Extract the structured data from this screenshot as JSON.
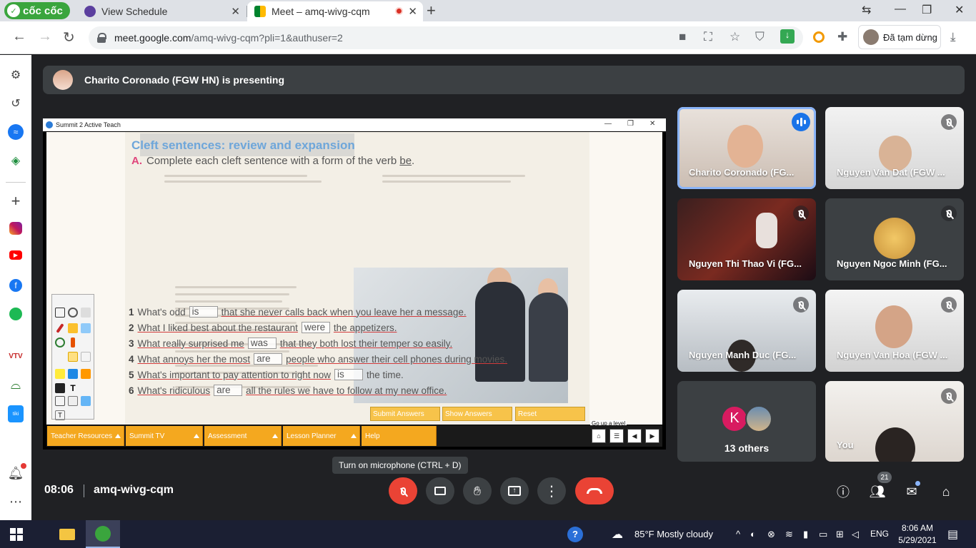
{
  "browser": {
    "brand": "cốc cốc",
    "tabs": [
      {
        "title": "View Schedule",
        "active": false
      },
      {
        "title": "Meet – amq-wivg-cqm",
        "active": true
      }
    ],
    "url_host": "meet.google.com",
    "url_path": "/amq-wivg-cqm?pli=1&authuser=2",
    "profile_label": "Đã tạm dừng"
  },
  "presenting_banner": "Charito Coronado (FGW HN) is presenting",
  "shared_window": {
    "title": "Summit 2 Active Teach",
    "heading": "Cleft sentences: review and expansion",
    "instruction_letter": "A.",
    "instruction": "Complete each cleft sentence with a form of the verb",
    "instruction_verb": "be",
    "sentences": [
      {
        "num": "1",
        "before": "What's odd",
        "answer": "is",
        "after": "that she never calls back when you leave her a message."
      },
      {
        "num": "2",
        "before": "What I liked best about the restaurant",
        "answer": "were",
        "after": "the appetizers."
      },
      {
        "num": "3",
        "before": "What really surprised me",
        "answer": "was",
        "after": "that they both lost their temper so easily."
      },
      {
        "num": "4",
        "before": "What annoys her the most",
        "answer": "are",
        "after": "people who answer their cell phones during movies."
      },
      {
        "num": "5",
        "before": "What's important to pay attention to right now",
        "answer": "is",
        "after": "the time."
      },
      {
        "num": "6",
        "before": "What's ridiculous",
        "answer": "are",
        "after": "all the rules we have to follow at my new office."
      }
    ],
    "answer_buttons": [
      "Submit Answers",
      "Show Answers",
      "Reset"
    ],
    "menu": [
      "Teacher Resources",
      "Summit TV",
      "Assessment",
      "Lesson Planner",
      "Help"
    ],
    "nav_tooltip": "Go up a level"
  },
  "participants": [
    {
      "name": "Charito Coronado (FG...",
      "state": "speaking"
    },
    {
      "name": "Nguyen Van Dat (FGW ...",
      "state": "muted"
    },
    {
      "name": "Nguyen Thi Thao Vi (FG...",
      "state": "muted"
    },
    {
      "name": "Nguyen Ngoc Minh (FG...",
      "state": "muted"
    },
    {
      "name": "Nguyen Manh Duc (FG...",
      "state": "muted"
    },
    {
      "name": "Nguyen Van Hoa (FGW ...",
      "state": "muted"
    },
    {
      "name": "You",
      "state": "muted"
    }
  ],
  "others": {
    "initial": "K",
    "label": "13 others"
  },
  "tooltip": "Turn on microphone (CTRL + D)",
  "meeting": {
    "time": "08:06",
    "code": "amq-wivg-cqm",
    "participant_count": "21"
  },
  "taskbar": {
    "weather": "85°F  Mostly cloudy",
    "lang": "ENG",
    "time": "8:06 AM",
    "date": "5/29/2021"
  },
  "colors": {
    "accent": "#1a73e8",
    "danger": "#ea4335",
    "meet_bg": "#202124",
    "tile_bg": "#3c4043"
  }
}
